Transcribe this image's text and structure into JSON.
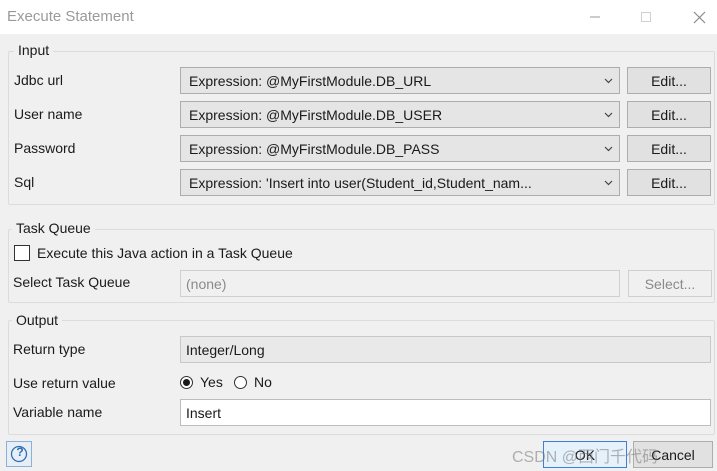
{
  "window": {
    "title": "Execute Statement",
    "controls": [
      "minimize-icon",
      "maximize-icon",
      "close-icon"
    ]
  },
  "input": {
    "title": "Input",
    "rows": [
      {
        "label": "Jdbc url",
        "value": "Expression: @MyFirstModule.DB_URL",
        "button": "Edit..."
      },
      {
        "label": "User name",
        "value": "Expression: @MyFirstModule.DB_USER",
        "button": "Edit..."
      },
      {
        "label": "Password",
        "value": "Expression: @MyFirstModule.DB_PASS",
        "button": "Edit..."
      },
      {
        "label": "Sql",
        "value": "Expression: 'Insert into user(Student_id,Student_nam...",
        "button": "Edit..."
      }
    ]
  },
  "task_queue": {
    "title": "Task Queue",
    "checkbox_label": "Execute this Java action in a Task Queue",
    "checked": false,
    "select_label": "Select Task Queue",
    "select_value": "(none)",
    "select_button": "Select..."
  },
  "output": {
    "title": "Output",
    "return_type_label": "Return type",
    "return_type_value": "Integer/Long",
    "use_return_label": "Use return value",
    "yes_label": "Yes",
    "no_label": "No",
    "selected": "Yes",
    "variable_name_label": "Variable name",
    "variable_name_value": "Insert"
  },
  "footer": {
    "help_glyph": "?",
    "ok_label": "OK",
    "cancel_label": "Cancel",
    "watermark": "CSDN @西门千代码"
  },
  "colors": {
    "window_bg": "#f0f0f0",
    "ok_border": "#3c7fd4",
    "help_border": "#8fb0d6"
  }
}
